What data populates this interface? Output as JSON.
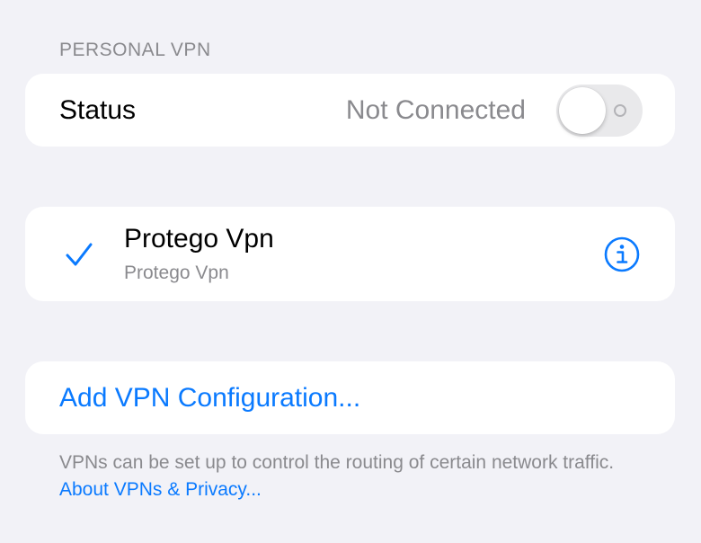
{
  "section": {
    "header": "PERSONAL VPN"
  },
  "status": {
    "label": "Status",
    "value": "Not Connected",
    "toggle_on": false
  },
  "vpn": {
    "name": "Protego Vpn",
    "subtitle": "Protego Vpn",
    "selected": true,
    "check_icon": "checkmark-icon",
    "info_icon": "info-circle-icon"
  },
  "add_config": {
    "label": "Add VPN Configuration..."
  },
  "footer": {
    "text": "VPNs can be set up to control the routing of certain network traffic.",
    "link": "About VPNs & Privacy..."
  },
  "colors": {
    "background": "#f2f2f7",
    "card": "#ffffff",
    "accent": "#0a7aff",
    "secondary_text": "#8a8a8e",
    "toggle_off": "#e9e9eb"
  }
}
